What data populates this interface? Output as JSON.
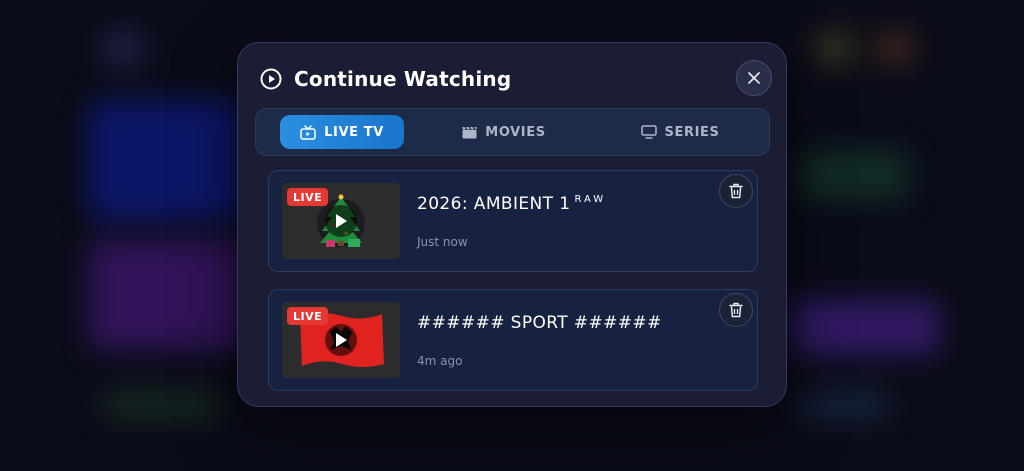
{
  "modal": {
    "title": "Continue Watching",
    "icons": {
      "title": "play-circle-icon",
      "close": "close-icon"
    }
  },
  "tabs": [
    {
      "label": "LIVE TV",
      "icon": "tv-icon",
      "active": true
    },
    {
      "label": "MOVIES",
      "icon": "clapperboard-icon",
      "active": false
    },
    {
      "label": "SERIES",
      "icon": "monitor-icon",
      "active": false
    }
  ],
  "items": [
    {
      "name": "2026: AMBIENT 1",
      "name_suffix": "RAW",
      "time": "Just now",
      "badge": "LIVE",
      "thumbnail": "christmas-tree-logo"
    },
    {
      "name": "###### SPORT ######",
      "name_suffix": "",
      "time": "4m ago",
      "badge": "LIVE",
      "thumbnail": "albanian-flag"
    }
  ],
  "colors": {
    "accent": "#1e88e5",
    "live_badge": "#e53935",
    "modal_bg": "#1a1d33",
    "card_bg": "#172240"
  }
}
